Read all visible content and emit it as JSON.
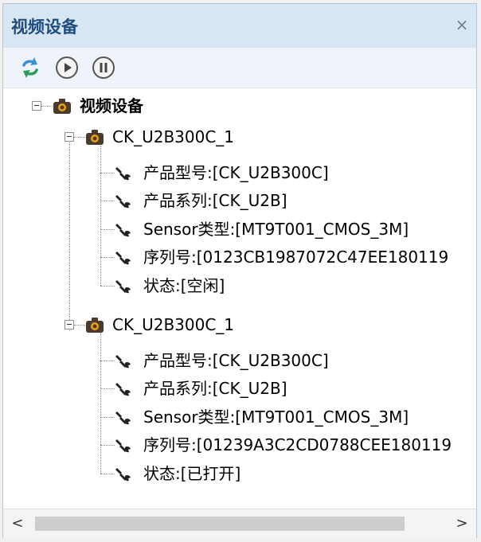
{
  "panel": {
    "title": "视频设备",
    "close_glyph": "×"
  },
  "toolbar": {
    "buttons": [
      {
        "name": "refresh-button",
        "icon": "refresh-icon"
      },
      {
        "name": "play-button",
        "icon": "play-icon"
      },
      {
        "name": "pause-button",
        "icon": "pause-icon"
      }
    ]
  },
  "tree": {
    "root_label": "视频设备",
    "devices": [
      {
        "label": "CK_U2B300C_1",
        "props": [
          "产品型号:[CK_U2B300C]",
          "产品系列:[CK_U2B]",
          "Sensor类型:[MT9T001_CMOS_3M]",
          "序列号:[0123CB1987072C47EE180119",
          "状态:[空闲]"
        ]
      },
      {
        "label": "CK_U2B300C_1",
        "props": [
          "产品型号:[CK_U2B300C]",
          "产品系列:[CK_U2B]",
          "Sensor类型:[MT9T001_CMOS_3M]",
          "序列号:[01239A3C2CD0788CEE180119",
          "状态:[已打开]"
        ]
      }
    ]
  },
  "scrollbar": {
    "left_arrow": "<",
    "right_arrow": ">"
  },
  "colors": {
    "title_text": "#1f4d7f",
    "title_bg": "#d8e6f4",
    "toolbar_bg": "#eef4fa"
  }
}
